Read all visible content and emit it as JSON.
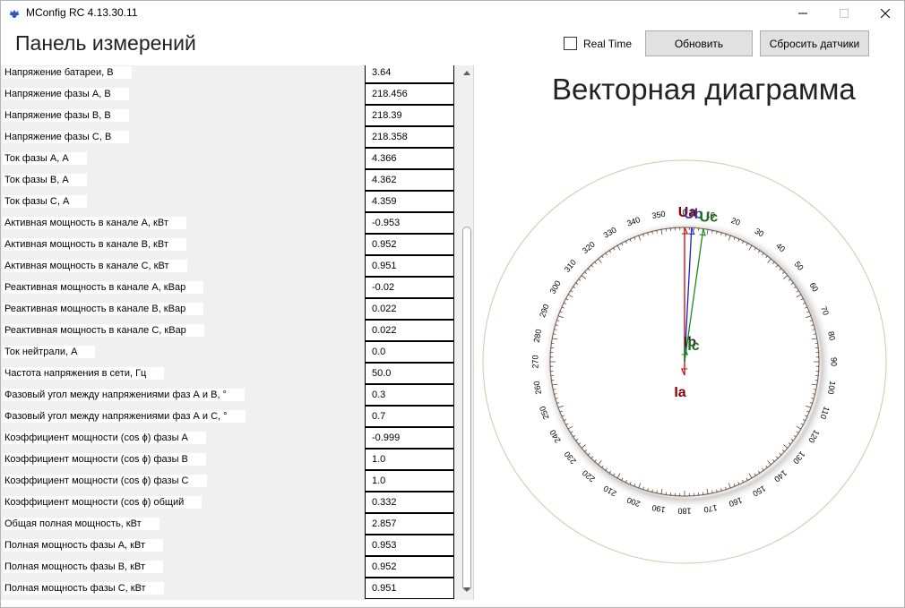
{
  "window": {
    "title": "MConfig RC 4.13.30.11"
  },
  "header": {
    "panel_title": "Панель измерений",
    "realtime_label": "Real Time",
    "realtime_checked": false,
    "refresh_label": "Обновить",
    "reset_label": "Сбросить датчики"
  },
  "measurements": [
    {
      "label": "Напряжение батареи, В",
      "value": "3.64"
    },
    {
      "label": "Напряжение фазы А, В",
      "value": "218.456"
    },
    {
      "label": "Напряжение фазы В, В",
      "value": "218.39"
    },
    {
      "label": "Напряжение фазы С, В",
      "value": "218.358"
    },
    {
      "label": "Ток фазы А, А",
      "value": "4.366"
    },
    {
      "label": "Ток фазы В, А",
      "value": "4.362"
    },
    {
      "label": "Ток фазы С, А",
      "value": "4.359"
    },
    {
      "label": "Активная мощность в канале А, кВт",
      "value": "-0.953"
    },
    {
      "label": "Активная мощность в канале В, кВт",
      "value": "0.952"
    },
    {
      "label": "Активная мощность в канале С, кВт",
      "value": "0.951"
    },
    {
      "label": "Реактивная мощность в канале А, кВар",
      "value": "-0.02"
    },
    {
      "label": "Реактивная мощность в канале В, кВар",
      "value": "0.022"
    },
    {
      "label": "Реактивная мощность в канале С, кВар",
      "value": "0.022"
    },
    {
      "label": "Ток нейтрали, А",
      "value": "0.0"
    },
    {
      "label": "Частота напряжения в сети, Гц",
      "value": "50.0"
    },
    {
      "label": "Фазовый угол между напряжениями фаз А и В, °",
      "value": "0.3"
    },
    {
      "label": "Фазовый угол между напряжениями фаз А и С, °",
      "value": "0.7"
    },
    {
      "label": "Коэффициент мощности (cos ϕ) фазы А",
      "value": "-0.999"
    },
    {
      "label": "Коэффициент мощности (cos ϕ) фазы В",
      "value": "1.0"
    },
    {
      "label": "Коэффициент мощности (cos ϕ) фазы С",
      "value": "1.0"
    },
    {
      "label": "Коэффициент мощности (cos ϕ) общий",
      "value": "0.332"
    },
    {
      "label": "Общая полная мощность, кВт",
      "value": "2.857"
    },
    {
      "label": "Полная мощность фазы А, кВт",
      "value": "0.953"
    },
    {
      "label": "Полная мощность фазы В, кВт",
      "value": "0.952"
    },
    {
      "label": "Полная мощность фазы С, кВт",
      "value": "0.951"
    }
  ],
  "diagram": {
    "title": "Векторная диаграмма",
    "dial_labels": [
      "0",
      "10",
      "20",
      "30",
      "40",
      "50",
      "60",
      "70",
      "80",
      "90",
      "100",
      "110",
      "120",
      "130",
      "140",
      "150",
      "160",
      "170",
      "180",
      "190",
      "200",
      "210",
      "220",
      "230",
      "240",
      "250",
      "260",
      "270",
      "280",
      "290",
      "300",
      "310",
      "320",
      "330",
      "340",
      "350"
    ],
    "vectors": [
      {
        "label": "Ua",
        "angle_deg": 0,
        "length": 1.0,
        "color": "#cc0000",
        "label_color": "#8b0000"
      },
      {
        "label": "Ub",
        "angle_deg": 3,
        "length": 1.0,
        "color": "#1f1fd0",
        "label_color": "#3a3a9a"
      },
      {
        "label": "Uc",
        "angle_deg": 8,
        "length": 1.0,
        "color": "#1a8a1a",
        "label_color": "#1e6e1e"
      },
      {
        "label": "Ia",
        "angle_deg": 180,
        "length": 0.1,
        "color": "#cc0000",
        "label_color": "#8b0000"
      },
      {
        "label": "Ib",
        "angle_deg": 0,
        "length": 0.1,
        "color": "#1f1fd0",
        "label_color": "#2a2a2a"
      },
      {
        "label": "Ic",
        "angle_deg": 0,
        "length": 0.1,
        "color": "#1a8a1a",
        "label_color": "#1e6e1e"
      }
    ],
    "colors": {
      "outer_ring": "#d8c4a8",
      "dial_circle": "#8a6a55",
      "tick": "#333333"
    }
  }
}
